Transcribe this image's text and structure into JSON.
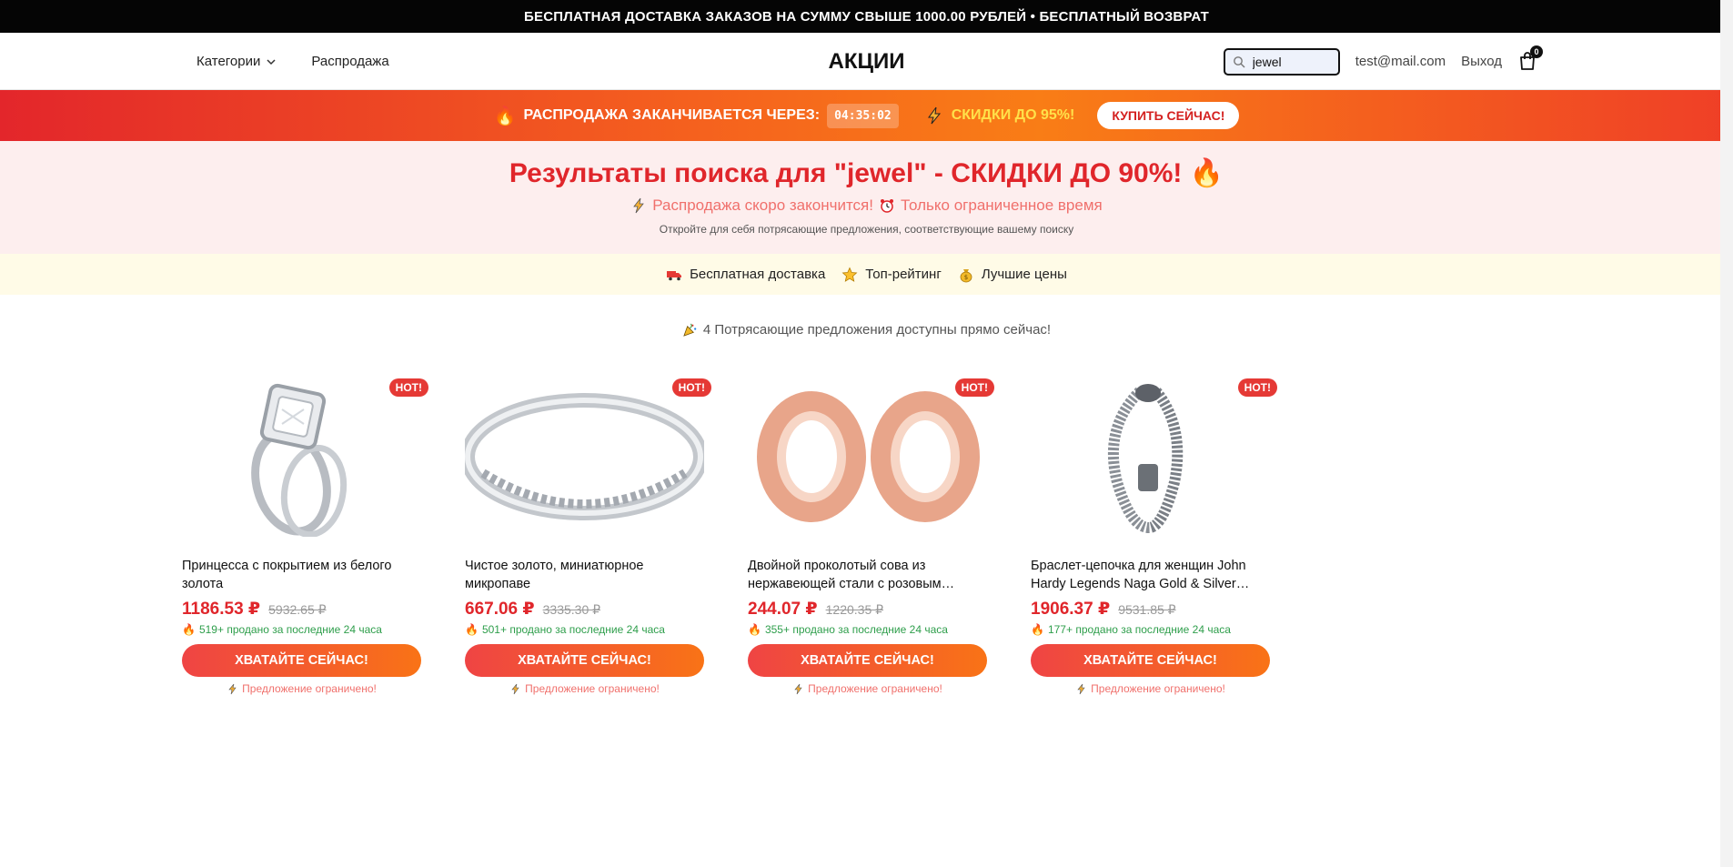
{
  "top_banner": "БЕСПЛАТНАЯ ДОСТАВКА ЗАКАЗОВ НА СУММУ СВЫШЕ 1000.00 РУБЛЕЙ • БЕСПЛАТНЫЙ ВОЗВРАТ",
  "header": {
    "categories": "Категории",
    "sale": "Распродажа",
    "logo": "АКЦИИ",
    "search_value": "jewel",
    "user_email": "test@mail.com",
    "logout": "Выход",
    "cart_count": "0"
  },
  "sale_bar": {
    "fire": "🔥",
    "label": "РАСПРОДАЖА ЗАКАНЧИВАЕТСЯ ЧЕРЕЗ:",
    "timer": "04:35:02",
    "discount": "СКИДКИ ДО 95%!",
    "buy_button": "КУПИТЬ СЕЙЧАС!"
  },
  "results": {
    "title": "Результаты поиска для \"jewel\" - СКИДКИ ДО 90%! 🔥",
    "subtitle_1": "Распродажа скоро закончится!",
    "subtitle_2": "Только ограниченное время",
    "description": "Откройте для себя потрясающие предложения, соответствующие вашему поиску"
  },
  "features": [
    {
      "label": "Бесплатная доставка",
      "icon": "truck-icon"
    },
    {
      "label": "Топ-рейтинг",
      "icon": "star-icon"
    },
    {
      "label": "Лучшие цены",
      "icon": "money-bag-icon"
    }
  ],
  "deals_count": "4 Потрясающие предложения доступны прямо сейчас!",
  "products": [
    {
      "hot": "HOT!",
      "title": "Принцесса с покрытием из белого золота",
      "price": "1186.53 ₽",
      "old_price": "5932.65 ₽",
      "sold": "519+ продано за последние 24 часа",
      "button": "ХВАТАЙТЕ СЕЙЧАС!",
      "limited": "Предложение ограничено!",
      "image": "diamond-ring-set"
    },
    {
      "hot": "HOT!",
      "title": "Чистое золото, миниатюрное микропаве",
      "price": "667.06 ₽",
      "old_price": "3335.30 ₽",
      "sold": "501+ продано за последние 24 часа",
      "button": "ХВАТАЙТЕ СЕЙЧАС!",
      "limited": "Предложение ограничено!",
      "image": "silver-band-ring"
    },
    {
      "hot": "HOT!",
      "title": "Двойной проколотый сова из нержавеющей стали с розовым золотом",
      "price": "244.07 ₽",
      "old_price": "1220.35 ₽",
      "sold": "355+ продано за последние 24 часа",
      "button": "ХВАТАЙТЕ СЕЙЧАС!",
      "limited": "Предложение ограничено!",
      "image": "rose-gold-plugs"
    },
    {
      "hot": "HOT!",
      "title": "Браслет-цепочка для женщин John Hardy Legends Naga Gold & Silver Dragon",
      "price": "1906.37 ₽",
      "old_price": "9531.85 ₽",
      "sold": "177+ продано за последние 24 часа",
      "button": "ХВАТАЙТЕ СЕЙЧАС!",
      "limited": "Предложение ограничено!",
      "image": "dragon-bracelet"
    }
  ],
  "colors": {
    "accent_red": "#e0262b",
    "accent_orange": "#f97316",
    "sold_green": "#2e9e4b"
  }
}
